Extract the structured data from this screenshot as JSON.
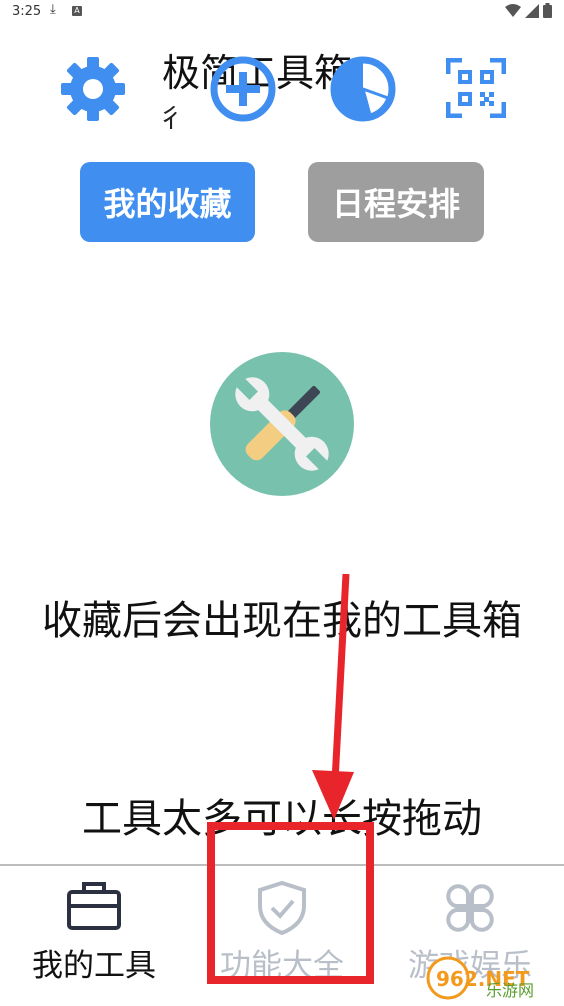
{
  "status_bar": {
    "time": "3:25",
    "download_icon": "download-icon",
    "a_icon": "A"
  },
  "header": {
    "title": "极简工具箱",
    "subtitle": "彳",
    "icons": [
      "gear-icon",
      "add-circle-icon",
      "pie-chart-icon",
      "qr-code-icon"
    ],
    "accent_color": "#3f8ef0"
  },
  "tabs": {
    "favorites": "我的收藏",
    "schedule": "日程安排"
  },
  "empty_state": {
    "icon": "tools-icon",
    "message": "收藏后会出现在我的工具箱",
    "hint": "工具太多可以长按拖动"
  },
  "bottom_nav": {
    "items": [
      {
        "label": "我的工具",
        "icon": "toolbox-icon"
      },
      {
        "label": "功能大全",
        "icon": "shield-check-icon"
      },
      {
        "label": "游戏娱乐",
        "icon": "clover-icon"
      }
    ]
  },
  "watermark": {
    "brand": "962.NET",
    "sub": "乐游网"
  },
  "annotation_color": "#e8252b"
}
